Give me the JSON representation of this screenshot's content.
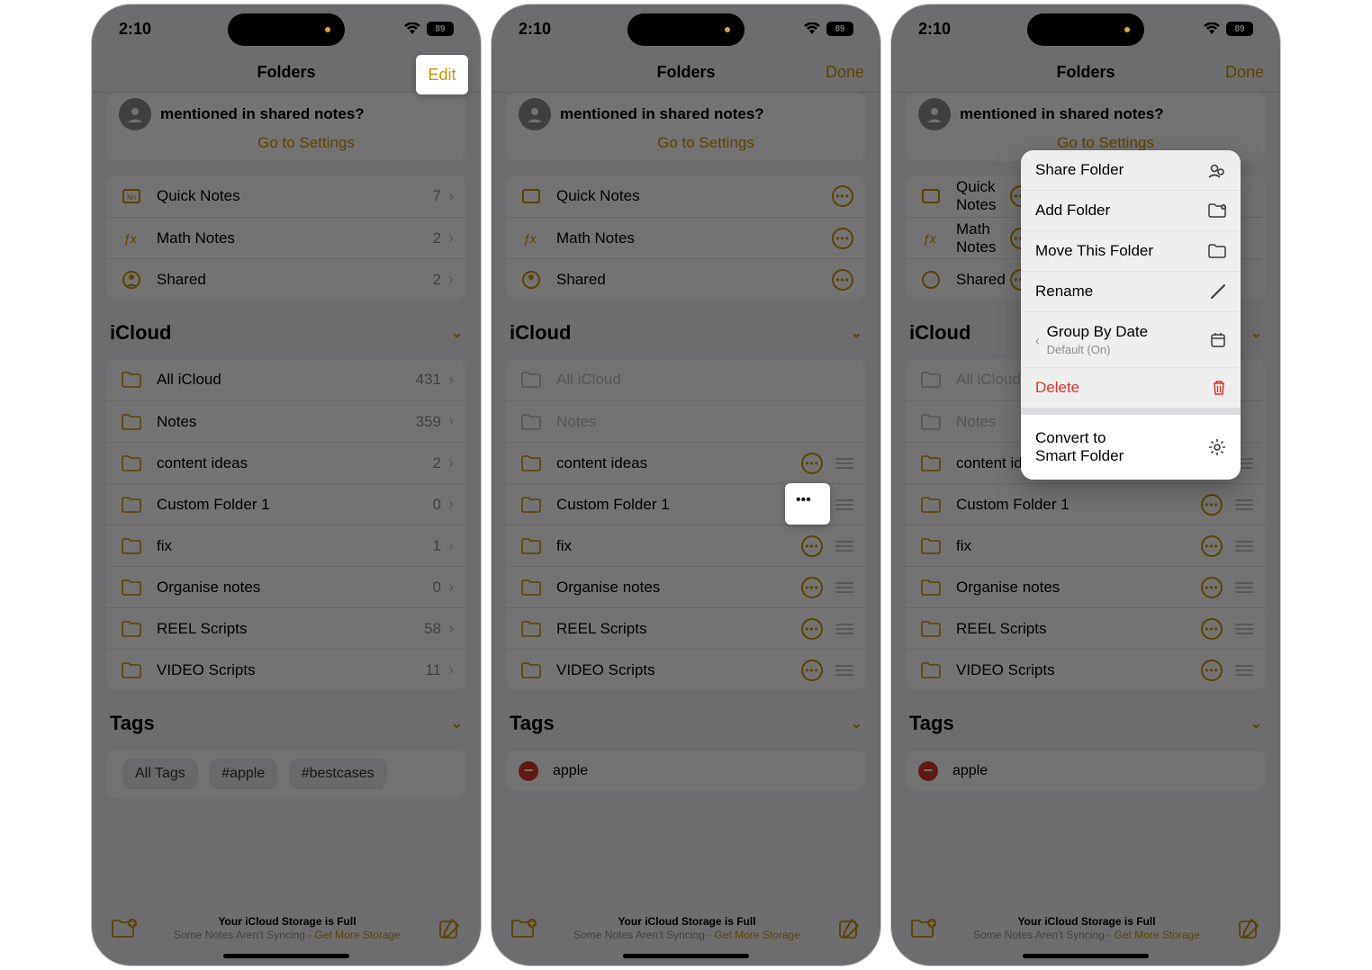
{
  "status": {
    "time": "2:10",
    "battery": "89"
  },
  "nav": {
    "title": "Folders",
    "edit": "Edit",
    "done": "Done"
  },
  "banner": {
    "question": "mentioned in shared notes?",
    "link": "Go to Settings"
  },
  "system_group": [
    {
      "icon": "quicknotes",
      "label": "Quick Notes",
      "count": "7"
    },
    {
      "icon": "math",
      "label": "Math Notes",
      "count": "2"
    },
    {
      "icon": "shared",
      "label": "Shared",
      "count": "2"
    }
  ],
  "icloud_header": "iCloud",
  "icloud_folders": [
    {
      "label": "All iCloud",
      "count": "431"
    },
    {
      "label": "Notes",
      "count": "359"
    },
    {
      "label": "content ideas",
      "count": "2"
    },
    {
      "label": "Custom Folder 1",
      "count": "0"
    },
    {
      "label": "fix",
      "count": "1"
    },
    {
      "label": "Organise notes",
      "count": "0"
    },
    {
      "label": "REEL Scripts",
      "count": "58"
    },
    {
      "label": "VIDEO Scripts",
      "count": "11"
    }
  ],
  "tags_header": "Tags",
  "tags": {
    "all": "All Tags",
    "t1": "#apple",
    "t2": "#bestcases",
    "edit_tag": "apple"
  },
  "footer": {
    "line1": "Your iCloud Storage is Full",
    "line2": "Some Notes Aren't Syncing - ",
    "link": "Get More Storage"
  },
  "context_menu": {
    "share": "Share Folder",
    "add": "Add Folder",
    "move": "Move This Folder",
    "rename": "Rename",
    "group": "Group By Date",
    "group_sub": "Default (On)",
    "delete": "Delete",
    "convert1": "Convert to",
    "convert2": "Smart Folder"
  }
}
